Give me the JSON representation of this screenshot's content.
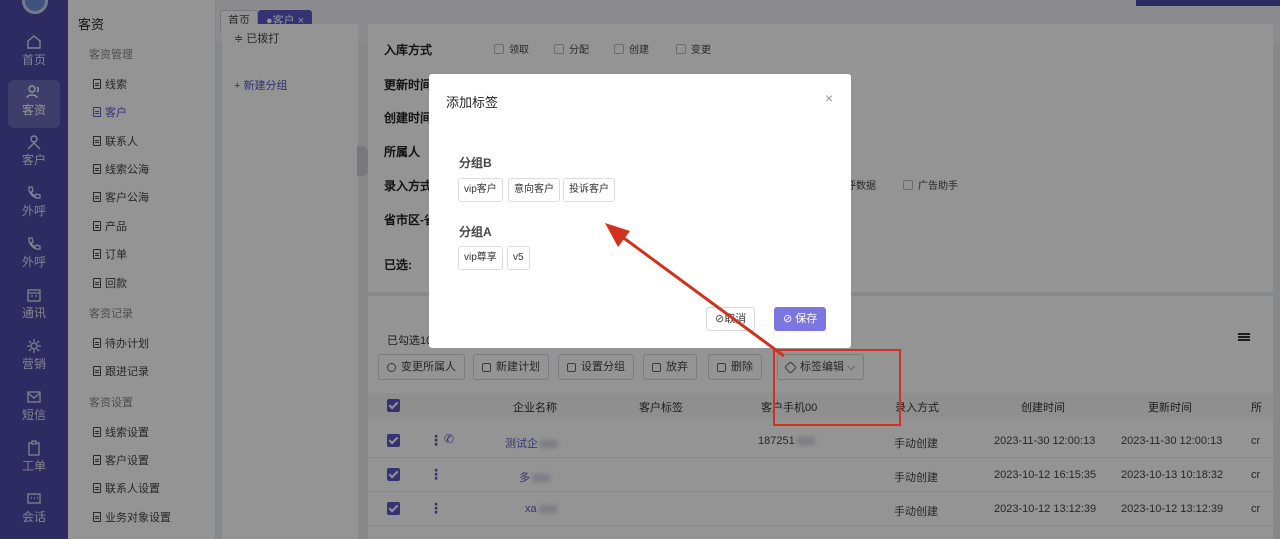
{
  "rail": [
    {
      "label": "首页",
      "icon": "home-icon"
    },
    {
      "label": "客资",
      "icon": "users-icon",
      "active": true
    },
    {
      "label": "客户",
      "icon": "person-icon"
    },
    {
      "label": "外呼",
      "icon": "phone-out-icon"
    },
    {
      "label": "外呼",
      "icon": "phone-call-icon"
    },
    {
      "label": "通讯",
      "icon": "calendar-icon"
    },
    {
      "label": "营销",
      "icon": "gear-icon"
    },
    {
      "label": "短信",
      "icon": "message-icon"
    },
    {
      "label": "工单",
      "icon": "clipboard-icon"
    },
    {
      "label": "会话",
      "icon": "chat-icon"
    }
  ],
  "subnav": {
    "title": "客资",
    "groups": [
      {
        "name": "客资管理",
        "items": [
          "线索",
          "客户",
          "联系人",
          "线索公海",
          "客户公海",
          "产品",
          "订单",
          "回款"
        ]
      },
      {
        "name": "客资记录",
        "items": [
          "待办计划",
          "跟进记录"
        ]
      },
      {
        "name": "客资设置",
        "items": [
          "线索设置",
          "客户设置",
          "联系人设置",
          "业务对象设置"
        ]
      }
    ],
    "active_item": "客户"
  },
  "tabs": {
    "home": "首页",
    "active": "●客户 ×"
  },
  "group_panel": {
    "first_row": "≑ 已拨打",
    "add_group": "+ 新建分组"
  },
  "filters": {
    "labels": [
      "入库方式",
      "更新时间",
      "创建时间",
      "所属人",
      "录入方式",
      "省市区-省",
      "已选:"
    ],
    "storage_options": [
      "领取",
      "分配",
      "创建",
      "变更"
    ],
    "entry_options_visible": [
      "呼数据",
      "广告助手"
    ]
  },
  "list": {
    "selected_text": "已勾选10",
    "buttons": [
      "变更所属人",
      "新建计划",
      "设置分组",
      "放弃",
      "删除",
      "标签编辑"
    ],
    "columns": [
      "企业名称",
      "客户标签",
      "客户手机00",
      "录入方式",
      "创建时间",
      "更新时间",
      "所"
    ],
    "rows": [
      {
        "name": "测试企",
        "phone": "187251",
        "entry": "手动创建",
        "created": "2023-11-30 12:00:13",
        "updated": "2023-11-30 12:00:13",
        "owner": "cr"
      },
      {
        "name": "多",
        "phone": "",
        "entry": "手动创建",
        "created": "2023-10-12 16:15:35",
        "updated": "2023-10-13 10:18:32",
        "owner": "cr"
      },
      {
        "name": "xa",
        "phone": "",
        "entry": "手动创建",
        "created": "2023-10-12 13:12:39",
        "updated": "2023-10-12 13:12:39",
        "owner": "cr"
      }
    ]
  },
  "modal": {
    "title": "添加标签",
    "close": "×",
    "groups": [
      {
        "name": "分组B",
        "tags": [
          "vip客户",
          "意向客户",
          "投诉客户"
        ]
      },
      {
        "name": "分组A",
        "tags": [
          "vip尊享",
          "v5"
        ]
      }
    ],
    "cancel": "取消",
    "save": "保存"
  },
  "colors": {
    "brand": "#4e4aa8",
    "accent": "#5b56c7",
    "save_button": "#7c77e0",
    "annotation": "#d2311d"
  }
}
